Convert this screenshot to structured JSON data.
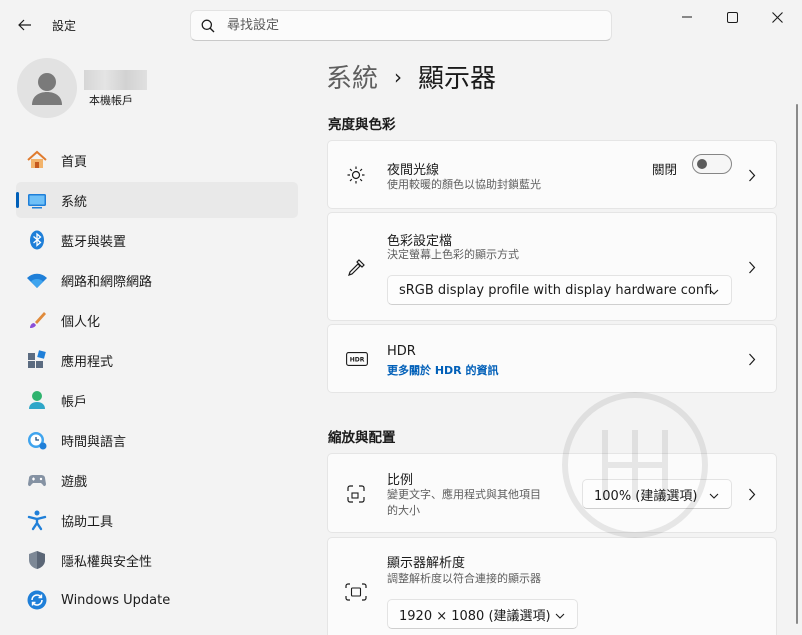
{
  "window": {
    "app_title": "設定",
    "back_icon": "back-arrow-icon",
    "minimize_icon": "minimize-icon",
    "maximize_icon": "maximize-icon",
    "close_icon": "close-icon"
  },
  "search": {
    "placeholder": "尋找設定",
    "value": ""
  },
  "account": {
    "subtitle": "本機帳戶"
  },
  "sidebar": {
    "items": [
      {
        "label": "首頁",
        "icon": "home-icon",
        "active": false
      },
      {
        "label": "系統",
        "icon": "system-display-icon",
        "active": true
      },
      {
        "label": "藍牙與裝置",
        "icon": "bluetooth-icon",
        "active": false
      },
      {
        "label": "網路和網際網路",
        "icon": "wifi-icon",
        "active": false
      },
      {
        "label": "個人化",
        "icon": "brush-icon",
        "active": false
      },
      {
        "label": "應用程式",
        "icon": "apps-icon",
        "active": false
      },
      {
        "label": "帳戶",
        "icon": "account-icon",
        "active": false
      },
      {
        "label": "時間與語言",
        "icon": "clock-globe-icon",
        "active": false
      },
      {
        "label": "遊戲",
        "icon": "gamepad-icon",
        "active": false
      },
      {
        "label": "協助工具",
        "icon": "accessibility-icon",
        "active": false
      },
      {
        "label": "隱私權與安全性",
        "icon": "shield-icon",
        "active": false
      },
      {
        "label": "Windows Update",
        "icon": "windows-update-icon",
        "active": false
      }
    ]
  },
  "breadcrumb": {
    "parent": "系統",
    "separator": "›",
    "current": "顯示器"
  },
  "sections": {
    "brightness": {
      "title": "亮度與色彩",
      "night_light": {
        "title": "夜間光線",
        "desc": "使用較暖的顏色以協助封鎖藍光",
        "toggle_label": "關閉",
        "toggle_on": false
      },
      "color_profile": {
        "title": "色彩設定檔",
        "desc": "決定螢幕上色彩的顯示方式",
        "selected": "sRGB display profile with display hardware confi"
      },
      "hdr": {
        "title": "HDR",
        "link": "更多關於 HDR 的資訊"
      }
    },
    "scale_layout": {
      "title": "縮放與配置",
      "scale": {
        "title": "比例",
        "desc_line1": "變更文字、應用程式與其他項目",
        "desc_line2": "的大小",
        "selected": "100% (建議選項)"
      },
      "resolution": {
        "title": "顯示器解析度",
        "desc": "調整解析度以符合連接的顯示器",
        "selected": "1920 × 1080 (建議選項)"
      }
    }
  },
  "colors": {
    "accent": "#005fb8",
    "background": "#f3f3f3",
    "card": "#fbfbfb"
  }
}
